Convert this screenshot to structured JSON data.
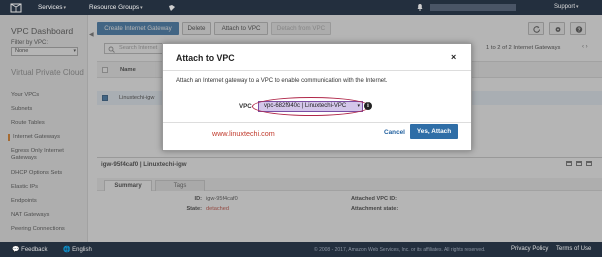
{
  "topnav": {
    "services_label": "Services",
    "resource_groups_label": "Resource Groups",
    "support_label": "Support"
  },
  "sidebar": {
    "title": "VPC Dashboard",
    "filter_label": "Filter by VPC:",
    "filter_value": "None",
    "section_title": "Virtual Private Cloud",
    "items": [
      {
        "label": "Your VPCs"
      },
      {
        "label": "Subnets"
      },
      {
        "label": "Route Tables"
      },
      {
        "label": "Internet Gateways"
      },
      {
        "label": "Egress Only Internet Gateways"
      },
      {
        "label": "DHCP Options Sets"
      },
      {
        "label": "Elastic IPs"
      },
      {
        "label": "Endpoints"
      },
      {
        "label": "NAT Gateways"
      },
      {
        "label": "Peering Connections"
      }
    ],
    "active_index": 3,
    "accent_color": "#e47911"
  },
  "toolbar": {
    "create_label": "Create Internet Gateway",
    "delete_label": "Delete",
    "attach_label": "Attach to VPC",
    "detach_label": "Detach from VPC",
    "icons": [
      "refresh-icon",
      "gear-icon",
      "help-icon"
    ]
  },
  "search": {
    "placeholder": "Search Internet"
  },
  "pager": {
    "text": "1 to 2 of 2 Internet Gateways"
  },
  "table": {
    "header_name": "Name",
    "rows": [
      {
        "name": "Linuxtechi-igw",
        "selected": true
      }
    ]
  },
  "detail": {
    "title": "igw-95f4caf0 | Linuxtechi-igw",
    "tabs": [
      "Summary",
      "Tags"
    ],
    "active_tab": 0,
    "fields": {
      "id_label": "ID:",
      "id_value": "igw-95f4caf0",
      "state_label": "State:",
      "state_value": "detached",
      "attached_vpc_label": "Attached VPC ID:",
      "attachment_state_label": "Attachment state:"
    },
    "state_color": "#c0392b"
  },
  "footer": {
    "feedback_label": "Feedback",
    "language_label": "English",
    "copyright": "© 2008 - 2017, Amazon Web Services, Inc. or its affiliates. All rights reserved.",
    "privacy_label": "Privacy Policy",
    "terms_label": "Terms of Use"
  },
  "modal": {
    "title": "Attach to VPC",
    "close_glyph": "×",
    "description": "Attach an Internet gateway to a VPC to enable communication with the Internet.",
    "vpc_label": "VPC",
    "vpc_value": "vpc-682f940c | Linuxtechi-VPC",
    "info_glyph": "i",
    "watermark": "www.linuxtechi.com",
    "cancel_label": "Cancel",
    "confirm_label": "Yes, Attach"
  },
  "colors": {
    "nav_bg": "#232f3e",
    "primary": "#2f6ea7",
    "highlight_ring": "#b0284a",
    "vpc_select_bg": "#d4c6ea"
  }
}
